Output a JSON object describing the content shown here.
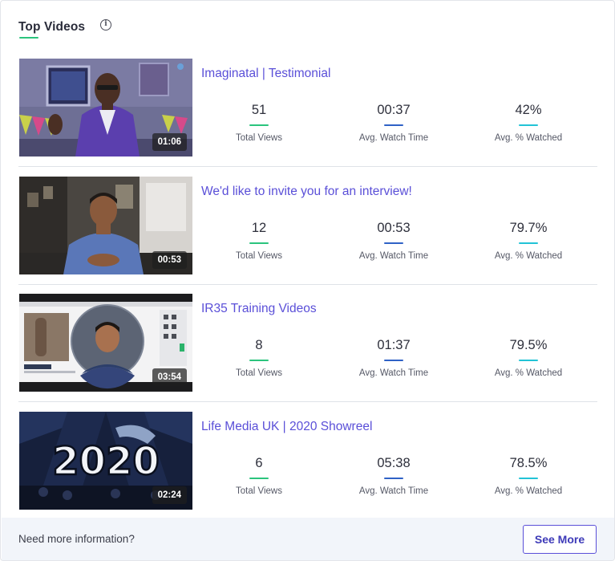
{
  "header": {
    "title": "Top Videos",
    "info_icon": "info-icon"
  },
  "stat_labels": {
    "views": "Total Views",
    "watch_time": "Avg. Watch Time",
    "pct_watched": "Avg. % Watched"
  },
  "colors": {
    "accent": "#5a4fd8",
    "views_bar": "#2bc47d",
    "watch_bar": "#2f62c6",
    "pct_bar": "#22c3d6"
  },
  "videos": [
    {
      "title": "Imaginatal | Testimonial",
      "duration": "01:06",
      "views": "51",
      "watch_time": "00:37",
      "pct_watched": "42%"
    },
    {
      "title": "We'd like to invite you for an interview!",
      "duration": "00:53",
      "views": "12",
      "watch_time": "00:53",
      "pct_watched": "79.7%"
    },
    {
      "title": "IR35 Training Videos",
      "duration": "03:54",
      "views": "8",
      "watch_time": "01:37",
      "pct_watched": "79.5%"
    },
    {
      "title": "Life Media UK | 2020 Showreel",
      "duration": "02:24",
      "views": "6",
      "watch_time": "05:38",
      "pct_watched": "78.5%",
      "thumb_text": "2020"
    }
  ],
  "footer": {
    "text": "Need more information?",
    "button": "See More"
  }
}
